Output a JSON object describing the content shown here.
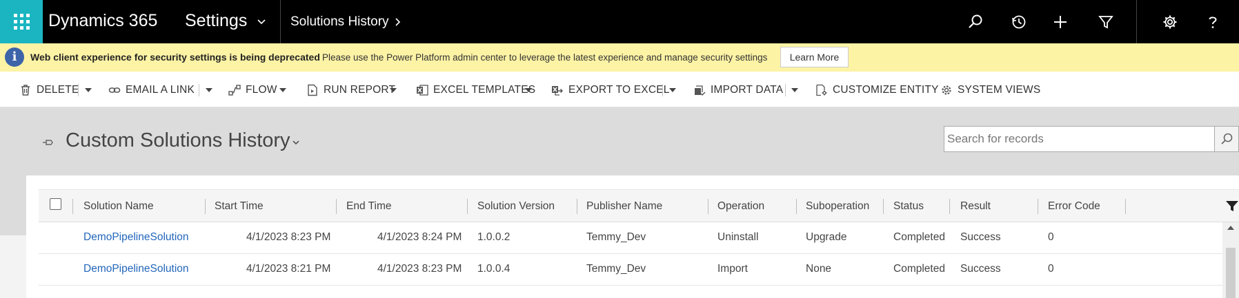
{
  "topbar": {
    "app_title": "Dynamics 365",
    "area": "Settings",
    "breadcrumb": "Solutions History"
  },
  "banner": {
    "title": "Web client experience for security settings is being deprecated",
    "message": "Please use the Power Platform admin center to leverage the latest experience and manage security settings",
    "button": "Learn More"
  },
  "commands": {
    "delete": "DELETE",
    "email_link": "EMAIL A LINK",
    "flow": "FLOW",
    "run_report": "RUN REPORT",
    "excel_templates": "EXCEL TEMPLATES",
    "export_excel": "EXPORT TO EXCEL",
    "import_data": "IMPORT DATA",
    "customize_entity": "CUSTOMIZE ENTITY",
    "system_views": "SYSTEM VIEWS"
  },
  "view": {
    "title": "Custom Solutions History",
    "search_placeholder": "Search for records"
  },
  "grid": {
    "columns": [
      "Solution Name",
      "Start Time",
      "End Time",
      "Solution Version",
      "Publisher Name",
      "Operation",
      "Suboperation",
      "Status",
      "Result",
      "Error Code"
    ],
    "rows": [
      [
        "DemoPipelineSolution",
        "4/1/2023 8:23 PM",
        "4/1/2023 8:24 PM",
        "1.0.0.2",
        "Temmy_Dev",
        "Uninstall",
        "Upgrade",
        "Completed",
        "Success",
        "0"
      ],
      [
        "DemoPipelineSolution",
        "4/1/2023 8:21 PM",
        "4/1/2023 8:23 PM",
        "1.0.0.4",
        "Temmy_Dev",
        "Import",
        "None",
        "Completed",
        "Success",
        "0"
      ]
    ]
  },
  "colors": {
    "accent": "#1ab5c1",
    "banner_bg": "#fdf3a5",
    "link": "#2266bb"
  }
}
